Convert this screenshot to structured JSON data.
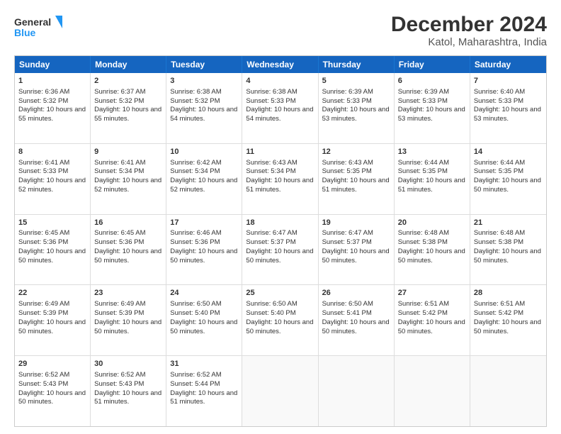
{
  "logo": {
    "line1": "General",
    "line2": "Blue"
  },
  "title": "December 2024",
  "subtitle": "Katol, Maharashtra, India",
  "weekdays": [
    "Sunday",
    "Monday",
    "Tuesday",
    "Wednesday",
    "Thursday",
    "Friday",
    "Saturday"
  ],
  "rows": [
    [
      {
        "day": "1",
        "sunrise": "6:36 AM",
        "sunset": "5:32 PM",
        "daylight": "10 hours and 55 minutes."
      },
      {
        "day": "2",
        "sunrise": "6:37 AM",
        "sunset": "5:32 PM",
        "daylight": "10 hours and 55 minutes."
      },
      {
        "day": "3",
        "sunrise": "6:38 AM",
        "sunset": "5:32 PM",
        "daylight": "10 hours and 54 minutes."
      },
      {
        "day": "4",
        "sunrise": "6:38 AM",
        "sunset": "5:33 PM",
        "daylight": "10 hours and 54 minutes."
      },
      {
        "day": "5",
        "sunrise": "6:39 AM",
        "sunset": "5:33 PM",
        "daylight": "10 hours and 53 minutes."
      },
      {
        "day": "6",
        "sunrise": "6:39 AM",
        "sunset": "5:33 PM",
        "daylight": "10 hours and 53 minutes."
      },
      {
        "day": "7",
        "sunrise": "6:40 AM",
        "sunset": "5:33 PM",
        "daylight": "10 hours and 53 minutes."
      }
    ],
    [
      {
        "day": "8",
        "sunrise": "6:41 AM",
        "sunset": "5:33 PM",
        "daylight": "10 hours and 52 minutes."
      },
      {
        "day": "9",
        "sunrise": "6:41 AM",
        "sunset": "5:34 PM",
        "daylight": "10 hours and 52 minutes."
      },
      {
        "day": "10",
        "sunrise": "6:42 AM",
        "sunset": "5:34 PM",
        "daylight": "10 hours and 52 minutes."
      },
      {
        "day": "11",
        "sunrise": "6:43 AM",
        "sunset": "5:34 PM",
        "daylight": "10 hours and 51 minutes."
      },
      {
        "day": "12",
        "sunrise": "6:43 AM",
        "sunset": "5:35 PM",
        "daylight": "10 hours and 51 minutes."
      },
      {
        "day": "13",
        "sunrise": "6:44 AM",
        "sunset": "5:35 PM",
        "daylight": "10 hours and 51 minutes."
      },
      {
        "day": "14",
        "sunrise": "6:44 AM",
        "sunset": "5:35 PM",
        "daylight": "10 hours and 50 minutes."
      }
    ],
    [
      {
        "day": "15",
        "sunrise": "6:45 AM",
        "sunset": "5:36 PM",
        "daylight": "10 hours and 50 minutes."
      },
      {
        "day": "16",
        "sunrise": "6:45 AM",
        "sunset": "5:36 PM",
        "daylight": "10 hours and 50 minutes."
      },
      {
        "day": "17",
        "sunrise": "6:46 AM",
        "sunset": "5:36 PM",
        "daylight": "10 hours and 50 minutes."
      },
      {
        "day": "18",
        "sunrise": "6:47 AM",
        "sunset": "5:37 PM",
        "daylight": "10 hours and 50 minutes."
      },
      {
        "day": "19",
        "sunrise": "6:47 AM",
        "sunset": "5:37 PM",
        "daylight": "10 hours and 50 minutes."
      },
      {
        "day": "20",
        "sunrise": "6:48 AM",
        "sunset": "5:38 PM",
        "daylight": "10 hours and 50 minutes."
      },
      {
        "day": "21",
        "sunrise": "6:48 AM",
        "sunset": "5:38 PM",
        "daylight": "10 hours and 50 minutes."
      }
    ],
    [
      {
        "day": "22",
        "sunrise": "6:49 AM",
        "sunset": "5:39 PM",
        "daylight": "10 hours and 50 minutes."
      },
      {
        "day": "23",
        "sunrise": "6:49 AM",
        "sunset": "5:39 PM",
        "daylight": "10 hours and 50 minutes."
      },
      {
        "day": "24",
        "sunrise": "6:50 AM",
        "sunset": "5:40 PM",
        "daylight": "10 hours and 50 minutes."
      },
      {
        "day": "25",
        "sunrise": "6:50 AM",
        "sunset": "5:40 PM",
        "daylight": "10 hours and 50 minutes."
      },
      {
        "day": "26",
        "sunrise": "6:50 AM",
        "sunset": "5:41 PM",
        "daylight": "10 hours and 50 minutes."
      },
      {
        "day": "27",
        "sunrise": "6:51 AM",
        "sunset": "5:42 PM",
        "daylight": "10 hours and 50 minutes."
      },
      {
        "day": "28",
        "sunrise": "6:51 AM",
        "sunset": "5:42 PM",
        "daylight": "10 hours and 50 minutes."
      }
    ],
    [
      {
        "day": "29",
        "sunrise": "6:52 AM",
        "sunset": "5:43 PM",
        "daylight": "10 hours and 50 minutes."
      },
      {
        "day": "30",
        "sunrise": "6:52 AM",
        "sunset": "5:43 PM",
        "daylight": "10 hours and 51 minutes."
      },
      {
        "day": "31",
        "sunrise": "6:52 AM",
        "sunset": "5:44 PM",
        "daylight": "10 hours and 51 minutes."
      },
      null,
      null,
      null,
      null
    ]
  ]
}
